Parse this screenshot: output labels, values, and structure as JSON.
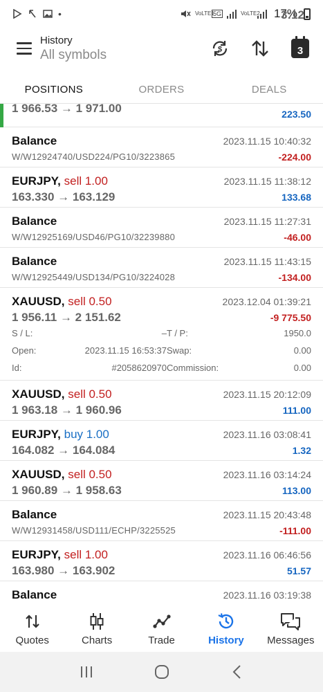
{
  "status_bar": {
    "time": "3:12",
    "net1": "VoLTE1",
    "net_5g": "5G",
    "net2": "VoLTE2",
    "battery": "17%"
  },
  "header": {
    "title": "History",
    "subtitle": "All symbols",
    "calendar_day": "3"
  },
  "tabs": [
    "POSITIONS",
    "ORDERS",
    "DEALS"
  ],
  "partial_row": {
    "prices": "1 966.53 → 1 971.00",
    "profit": "223.50"
  },
  "rows": [
    {
      "kind": "balance",
      "title": "Balance",
      "comment": "W/W12924740/USD224/PG10/3223865",
      "time": "2023.11.15 10:40:32",
      "profit": "-224.00",
      "sign": "neg"
    },
    {
      "kind": "trade",
      "symbol": "EURJPY,",
      "side": "sell 1.00",
      "dir": "sell",
      "prices": "163.330 → 163.129",
      "time": "2023.11.15 11:38:12",
      "profit": "133.68",
      "sign": "pos"
    },
    {
      "kind": "balance",
      "title": "Balance",
      "comment": "W/W12925169/USD46/PG10/32239880",
      "time": "2023.11.15 11:27:31",
      "profit": "-46.00",
      "sign": "neg"
    },
    {
      "kind": "balance",
      "title": "Balance",
      "comment": "W/W12925449/USD134/PG10/3224028",
      "time": "2023.11.15 11:43:15",
      "profit": "-134.00",
      "sign": "neg"
    }
  ],
  "expanded": {
    "symbol": "XAUUSD,",
    "side": "sell 0.50",
    "prices": "1 956.11 → 2 151.62",
    "time": "2023.12.04 01:39:21",
    "profit": "-9 775.50",
    "sl_label": "S / L:",
    "sl_value": "–",
    "tp_label": "T / P:",
    "tp_value": "1950.0",
    "open_label": "Open:",
    "open_value": "2023.11.15 16:53:37",
    "swap_label": "Swap:",
    "swap_value": "0.00",
    "id_label": "Id:",
    "id_value": "#2058620970",
    "commission_label": "Commission:",
    "commission_value": "0.00"
  },
  "rows2": [
    {
      "kind": "trade",
      "symbol": "XAUUSD,",
      "side": "sell 0.50",
      "dir": "sell",
      "prices": "1 963.18 → 1 960.96",
      "time": "2023.11.15 20:12:09",
      "profit": "111.00",
      "sign": "pos"
    },
    {
      "kind": "trade",
      "symbol": "EURJPY,",
      "side": "buy 1.00",
      "dir": "buy",
      "prices": "164.082 → 164.084",
      "time": "2023.11.16 03:08:41",
      "profit": "1.32",
      "sign": "pos"
    },
    {
      "kind": "trade",
      "symbol": "XAUUSD,",
      "side": "sell 0.50",
      "dir": "sell",
      "prices": "1 960.89 → 1 958.63",
      "time": "2023.11.16 03:14:24",
      "profit": "113.00",
      "sign": "pos"
    },
    {
      "kind": "balance",
      "title": "Balance",
      "comment": "W/W12931458/USD111/ECHP/3225525",
      "time": "2023.11.15 20:43:48",
      "profit": "-111.00",
      "sign": "neg"
    },
    {
      "kind": "trade",
      "symbol": "EURJPY,",
      "side": "sell 1.00",
      "dir": "sell",
      "prices": "163.980 → 163.902",
      "time": "2023.11.16 06:46:56",
      "profit": "51.57",
      "sign": "pos"
    },
    {
      "kind": "balance",
      "title": "Balance",
      "comment": "",
      "time": "2023.11.16 03:19:38",
      "profit": "",
      "sign": "neg"
    }
  ],
  "bottom_nav": [
    {
      "label": "Quotes",
      "icon": "quotes-icon"
    },
    {
      "label": "Charts",
      "icon": "charts-icon"
    },
    {
      "label": "Trade",
      "icon": "trade-icon"
    },
    {
      "label": "History",
      "icon": "history-icon",
      "active": true
    },
    {
      "label": "Messages",
      "icon": "messages-icon"
    }
  ],
  "colors": {
    "profit_positive": "#1565c0",
    "profit_negative": "#c21f1f",
    "sell": "#c21f1f",
    "buy": "#1a6fc4",
    "active_nav": "#1a73e8",
    "position_marker": "#35a845"
  }
}
